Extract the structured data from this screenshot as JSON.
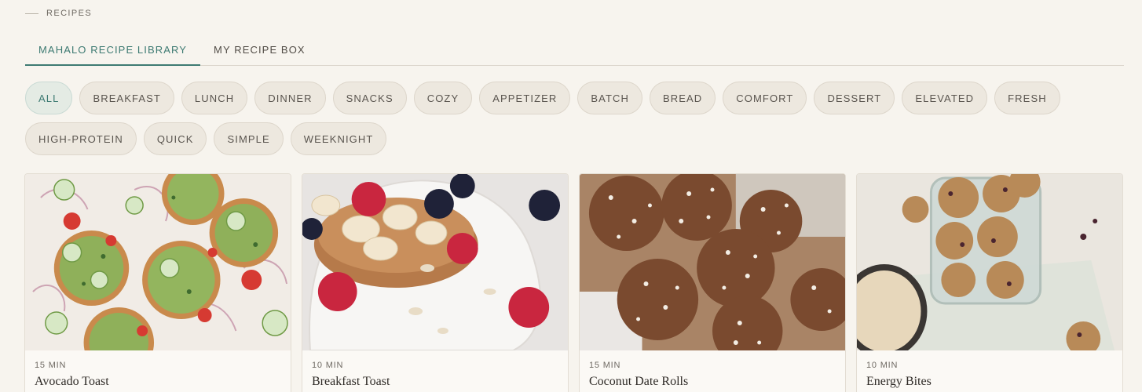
{
  "section": {
    "eyebrow": "RECIPES"
  },
  "tabs": [
    {
      "label": "MAHALO RECIPE LIBRARY",
      "active": true
    },
    {
      "label": "MY RECIPE BOX",
      "active": false
    }
  ],
  "filters": [
    "ALL",
    "BREAKFAST",
    "LUNCH",
    "DINNER",
    "SNACKS",
    "COZY",
    "APPETIZER",
    "BATCH",
    "BREAD",
    "COMFORT",
    "DESSERT",
    "ELEVATED",
    "FRESH",
    "HIGH-PROTEIN",
    "QUICK",
    "SIMPLE",
    "WEEKNIGHT"
  ],
  "active_filter": "ALL",
  "recipes": [
    {
      "time": "15 MIN",
      "title": "Avocado Toast"
    },
    {
      "time": "10 MIN",
      "title": "Breakfast Toast"
    },
    {
      "time": "15 MIN",
      "title": "Coconut Date Rolls"
    },
    {
      "time": "10 MIN",
      "title": "Energy Bites"
    }
  ],
  "colors": {
    "accent": "#3d7a72",
    "background": "#f7f4ee",
    "chip": "#ede8df"
  }
}
